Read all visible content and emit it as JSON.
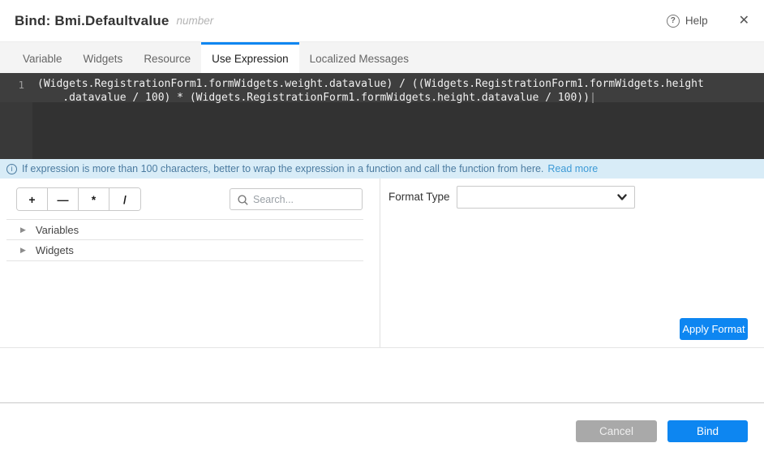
{
  "header": {
    "title": "Bind: Bmi.Defaultvalue",
    "type_hint": "number",
    "help_icon": "?",
    "help_label": "Help",
    "close_icon": "✕"
  },
  "tabs": [
    {
      "label": "Variable",
      "active": false
    },
    {
      "label": "Widgets",
      "active": false
    },
    {
      "label": "Resource",
      "active": false
    },
    {
      "label": "Use Expression",
      "active": true
    },
    {
      "label": "Localized Messages",
      "active": false
    }
  ],
  "editor": {
    "line_number": "1",
    "line1": "(Widgets.RegistrationForm1.formWidgets.weight.datavalue) / ((Widgets.RegistrationForm1.formWidgets.height",
    "line2": "    .datavalue / 100) * (Widgets.RegistrationForm1.formWidgets.height.datavalue / 100))"
  },
  "info_bar": {
    "icon": "i",
    "message": "If expression is more than 100 characters, better to wrap the expression in a function and call the function from here.",
    "link_label": "Read more"
  },
  "expression_toolbar": {
    "operators": [
      "+",
      "—",
      "*",
      "/"
    ],
    "search_placeholder": "Search..."
  },
  "tree": {
    "caret_icon": "▶",
    "items": [
      {
        "label": "Variables"
      },
      {
        "label": "Widgets"
      }
    ]
  },
  "format_panel": {
    "label": "Format Type",
    "selected_value": "",
    "apply_button": "Apply Format"
  },
  "footer": {
    "cancel_button": "Cancel",
    "bind_button": "Bind"
  },
  "colors": {
    "accent_blue": "#0d86f1",
    "editor_background": "#323232",
    "info_background": "#d8ecf7",
    "cancel_gray": "#a9a9a9"
  }
}
